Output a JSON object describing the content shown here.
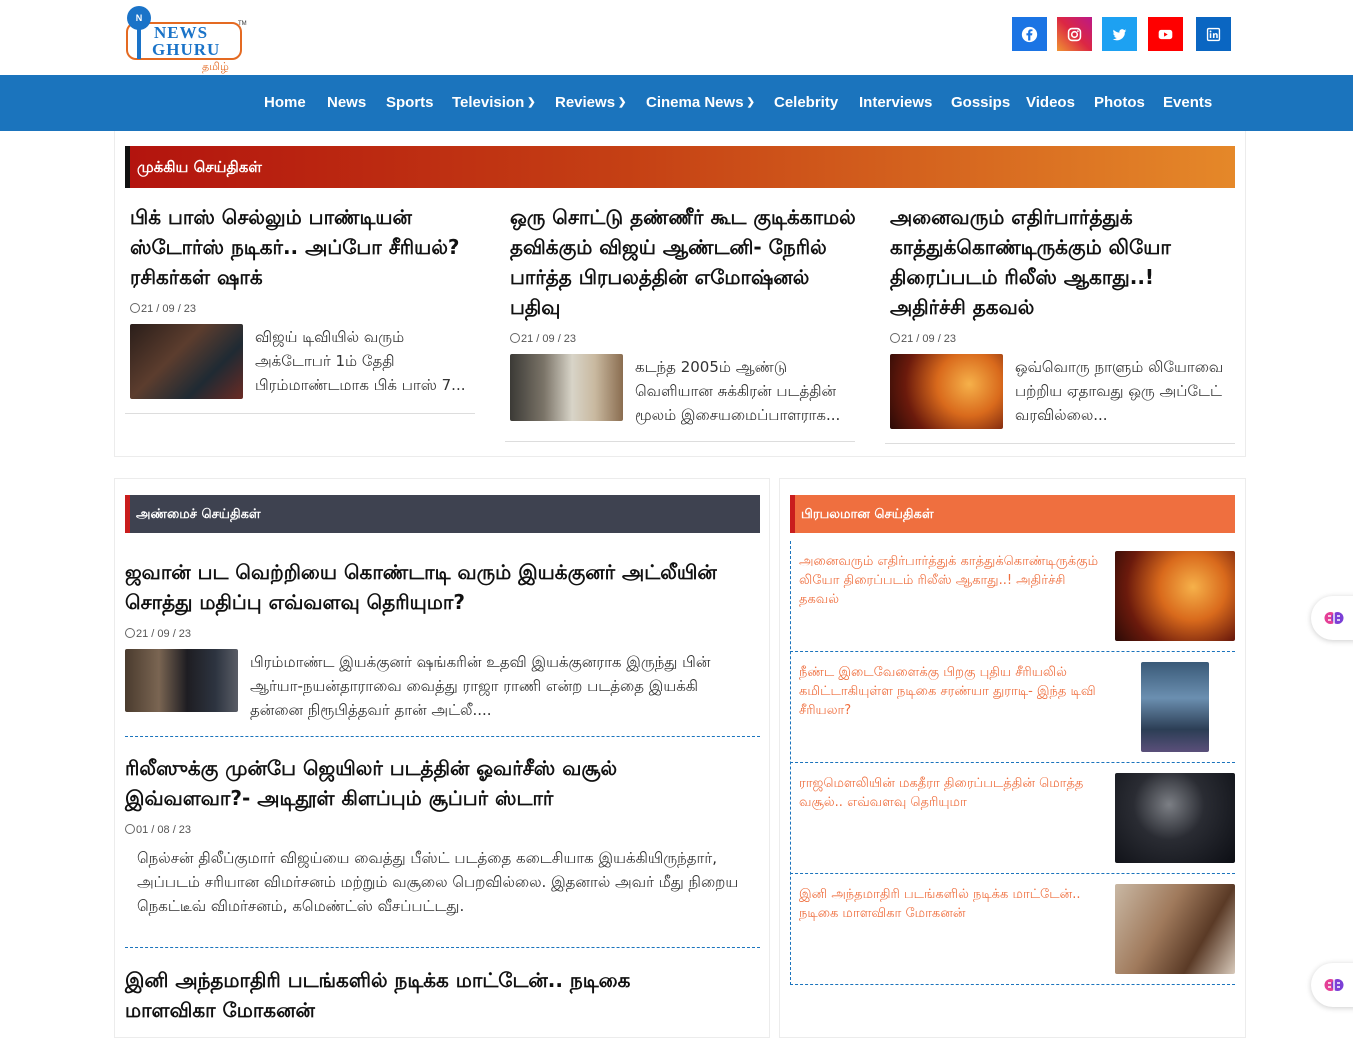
{
  "brand": {
    "line1": "NEWS",
    "line2": "GHURU",
    "tm": "TM",
    "lang": "தமிழ்"
  },
  "social": [
    {
      "icon": "facebook-icon",
      "color": "#1b74e4"
    },
    {
      "icon": "instagram-icon",
      "color": "#c2378f"
    },
    {
      "icon": "twitter-icon",
      "color": "#1da1f2"
    },
    {
      "icon": "youtube-icon",
      "color": "#ff0000"
    },
    {
      "icon": "linkedin-icon",
      "color": "#0a66c2"
    }
  ],
  "nav": {
    "items": [
      "Home",
      "News",
      "Sports",
      "Television",
      "Reviews",
      "Cinema News",
      "Celebrity",
      "Interviews",
      "Gossips",
      "Videos",
      "Photos",
      "Events"
    ]
  },
  "top_news": {
    "heading": "முக்கிய செய்திகள்",
    "articles": [
      {
        "title": "பிக் பாஸ் செல்லும் பாண்டியன் ஸ்டோர்ஸ் நடிகர்.. அப்போ சீரியல்? ரசிகர்கள் ஷாக்",
        "date": "21 / 09 / 23",
        "excerpt": "விஜய் டிவியில் வரும் அக்டோபர் 1ம் தேதி பிரம்மாண்டமாக பிக் பாஸ் 7..."
      },
      {
        "title": "ஒரு சொட்டு தண்ணீர் கூட குடிக்காமல் தவிக்கும் விஜய் ஆண்டனி- நேரில் பார்த்த பிரபலத்தின் எமோஷ்னல் பதிவு",
        "date": "21 / 09 / 23",
        "excerpt": "கடந்த 2005ம் ஆண்டு வெளியான சுக்கிரன் படத்தின் மூலம் இசையமைப்பாளராக..."
      },
      {
        "title": "அனைவரும் எதிர்பார்த்துக் காத்துக்கொண்டிருக்கும் லியோ திரைப்படம் ரிலீஸ் ஆகாது..! அதிர்ச்சி தகவல்",
        "date": "21 / 09 / 23",
        "excerpt": "ஒவ்வொரு நாளும் லியோவை பற்றிய ஏதாவது ஒரு அப்டேட் வரவில்லை..."
      }
    ]
  },
  "recent_news": {
    "heading": "அண்மைச் செய்திகள்",
    "articles": [
      {
        "title": "ஜவான் பட வெற்றியை கொண்டாடி வரும் இயக்குனர் அட்லீயின் சொத்து மதிப்பு எவ்வளவு தெரியுமா?",
        "date": "21 / 09 / 23",
        "excerpt": "பிரம்மாண்ட இயக்குனர் ஷங்கரின் உதவி இயக்குனராக இருந்து பின் ஆர்யா-நயன்தாராவை வைத்து ராஜா ராணி என்ற படத்தை இயக்கி தன்னை நிரூபித்தவர் தான் அட்லீ...."
      },
      {
        "title": "ரிலீஸுக்கு முன்பே ஜெயிலர் படத்தின் ஓவர்சீஸ் வசூல் இவ்வளவா?- அடிதூள் கிளப்பும் சூப்பர் ஸ்டார்",
        "date": "01 / 08 / 23",
        "excerpt": "நெல்சன் திலீப்குமார் விஜய்யை வைத்து பீஸ்ட் படத்தை கடைசியாக இயக்கியிருந்தார், அப்படம் சரியான விமர்சனம் மற்றும் வசூலை பெறவில்லை. இதனால் அவர் மீது நிறைய நெகட்டீவ் விமர்சனம், கமெண்ட்ஸ் வீசப்பட்டது."
      },
      {
        "title": "இனி அந்தமாதிரி படங்களில் நடிக்க மாட்டேன்.. நடிகை மாளவிகா மோகனன்"
      }
    ]
  },
  "popular_news": {
    "heading": "பிரபலமான செய்திகள்",
    "items": [
      "அனைவரும் எதிர்பார்த்துக் காத்துக்கொண்டிருக்கும் லியோ திரைப்படம் ரிலீஸ் ஆகாது..! அதிர்ச்சி தகவல்",
      "நீண்ட இடைவேளைக்கு பிறகு புதிய சீரியலில் கமிட்டாகியுள்ள நடிகை சரண்யா துராடி- இந்த டிவி சீரியலா?",
      "ராஜமௌலியின் மகதீரா திரைப்படத்தின் மொத்த வசூல்.. எவ்வளவு தெரியுமா",
      "இனி அந்தமாதிரி படங்களில் நடிக்க மாட்டேன்.. நடிகை மாளவிகா மோகனன்"
    ]
  }
}
